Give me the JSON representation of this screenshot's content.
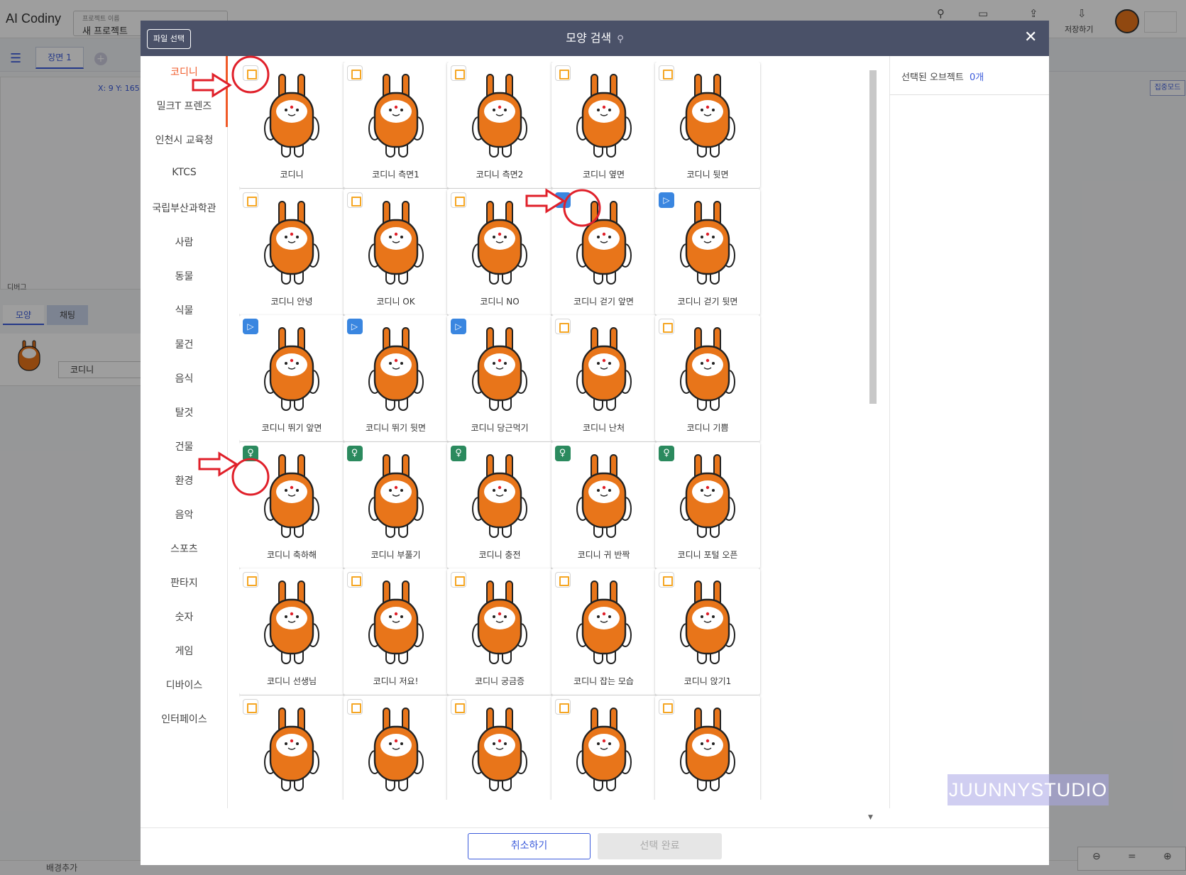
{
  "app": {
    "logo": "AI Codiny",
    "project_label": "프로젝트 이름",
    "project_name": "새 프로젝트",
    "save_label": "저장하기",
    "scene_tab": "장면 1",
    "coords": "X: 9 Y: 165",
    "debug_label": "디버그",
    "tab_shape": "모양",
    "tab_chat": "채팅",
    "object_name": "코디니",
    "focus_mode": "집중모드",
    "bottom_add_bg": "배경추가"
  },
  "modal": {
    "file_select": "파일 선택",
    "title": "모양 검색",
    "close": "✕",
    "selected_label": "선택된 오브젝트",
    "selected_count": "0개",
    "cancel": "취소하기",
    "done": "선택 완료",
    "watermark": "JUUNNYSTUDIO"
  },
  "categories": [
    "코디니",
    "밀크T 프렌즈",
    "인천시 교육청",
    "KTCS",
    "국립부산과학관",
    "사람",
    "동물",
    "식물",
    "물건",
    "음식",
    "탈것",
    "건물",
    "환경",
    "음악",
    "스포츠",
    "판타지",
    "숫자",
    "게임",
    "디바이스",
    "인터페이스"
  ],
  "active_category": "코디니",
  "cards": [
    {
      "label": "코디니",
      "badge": "img"
    },
    {
      "label": "코디니 측면1",
      "badge": "img"
    },
    {
      "label": "코디니 측면2",
      "badge": "img"
    },
    {
      "label": "코디니 옆면",
      "badge": "img"
    },
    {
      "label": "코디니 뒷면",
      "badge": "img"
    },
    {
      "label": "코디니 안녕",
      "badge": "img"
    },
    {
      "label": "코디니 OK",
      "badge": "img"
    },
    {
      "label": "코디니 NO",
      "badge": "img"
    },
    {
      "label": "코디니 걷기 앞면",
      "badge": "anim"
    },
    {
      "label": "코디니 걷기 뒷면",
      "badge": "anim"
    },
    {
      "label": "코디니 뛰기 앞면",
      "badge": "anim"
    },
    {
      "label": "코디니 뛰기 뒷면",
      "badge": "anim"
    },
    {
      "label": "코디니 당근먹기",
      "badge": "anim"
    },
    {
      "label": "코디니 난처",
      "badge": "img"
    },
    {
      "label": "코디니 기쁨",
      "badge": "img"
    },
    {
      "label": "코디니 축하해",
      "badge": "ai"
    },
    {
      "label": "코디니 부풀기",
      "badge": "ai"
    },
    {
      "label": "코디니 충전",
      "badge": "ai"
    },
    {
      "label": "코디니 귀 반짝",
      "badge": "ai"
    },
    {
      "label": "코디니 포털 오픈",
      "badge": "ai"
    },
    {
      "label": "코디니 선생님",
      "badge": "img"
    },
    {
      "label": "코디니 저요!",
      "badge": "img"
    },
    {
      "label": "코디니 궁금증",
      "badge": "img"
    },
    {
      "label": "코디니 잡는 모습",
      "badge": "img"
    },
    {
      "label": "코디니 앉기1",
      "badge": "img"
    },
    {
      "label": "",
      "badge": "img"
    },
    {
      "label": "",
      "badge": "img"
    },
    {
      "label": "",
      "badge": "img"
    },
    {
      "label": "",
      "badge": "img"
    },
    {
      "label": "",
      "badge": "img"
    }
  ],
  "colors": {
    "accent": "#3b5bdb",
    "active_category": "#f05a28",
    "character_orange": "#e8751a",
    "header": "#4a5168",
    "annotation": "#e0202a"
  }
}
